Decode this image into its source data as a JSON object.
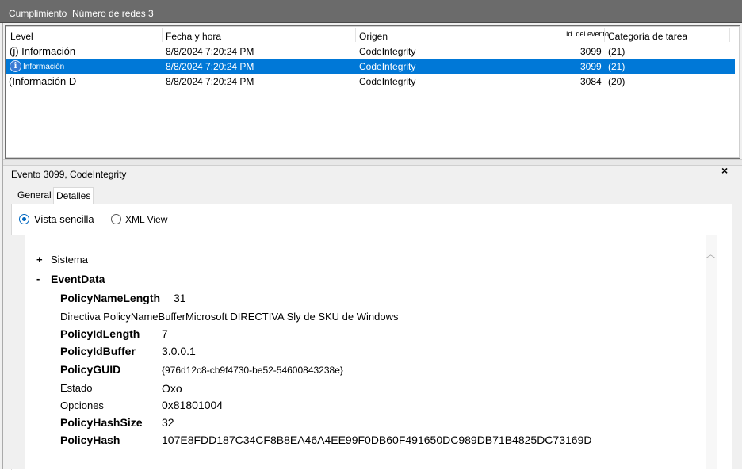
{
  "topbar": {
    "item1": "Cumplimiento",
    "item2": "Número de redes 3"
  },
  "columns": {
    "level": "Level",
    "date": "Fecha y hora",
    "source": "Origen",
    "event_id": "Id. del evento",
    "category": "Categoría de tarea"
  },
  "rows": [
    {
      "level": "(j) Información",
      "date": "8/8/2024 7:20:24 PM",
      "source": "CodeIntegrity",
      "event_id": "3099",
      "category": "(21)"
    },
    {
      "level": "Información",
      "date": "8/8/2024 7:20:24 PM",
      "source": "CodeIntegrity",
      "event_id": "3099",
      "category": "(21)"
    },
    {
      "level": "(Información D",
      "date": "8/8/2024 7:20:24 PM",
      "source": "CodeIntegrity",
      "event_id": "3084",
      "category": "(20)"
    }
  ],
  "event_panel": {
    "title": "Evento 3099, CodeIntegrity",
    "close": "×",
    "tabs": {
      "general": "General",
      "details": "Detalles"
    },
    "radio_simple": "Vista sencilla",
    "radio_xml": "XML View",
    "tree": {
      "system_toggle": "+",
      "system_label": "Sistema",
      "eventdata_toggle": "-",
      "eventdata_label": "EventData"
    },
    "fields": {
      "f1_key": "PolicyNameLength",
      "f1_val": "31",
      "f2_text": "Directiva PolicyNameBufferMicrosoft DIRECTIVA Sly de SKU de Windows",
      "f3_key": "PolicyIdLength",
      "f3_val": "7",
      "f4_key": "PolicyIdBuffer",
      "f4_val": "3.0.0.1",
      "f5_key": "PolicyGUID",
      "f5_val": "{976d12c8-cb9f4730-be52-54600843238e}",
      "f6_key": "Estado",
      "f6_val": "Oxo",
      "f7_key": "Opciones",
      "f7_val": "0x81801004",
      "f8_key": "PolicyHashSize",
      "f8_val": "32",
      "f9_key": "PolicyHash",
      "f9_val": "107E8FDD187C34CF8B8EA46A4EE99F0DB60F491650DC989DB71B4825DC73169D"
    }
  },
  "icons": {
    "info": "info-icon",
    "close": "close-icon",
    "scroll_up": "chevron-up-icon"
  },
  "colors": {
    "selection": "#0078d7",
    "topbar": "#6b6b6b",
    "radio_accent": "#0067c0"
  }
}
